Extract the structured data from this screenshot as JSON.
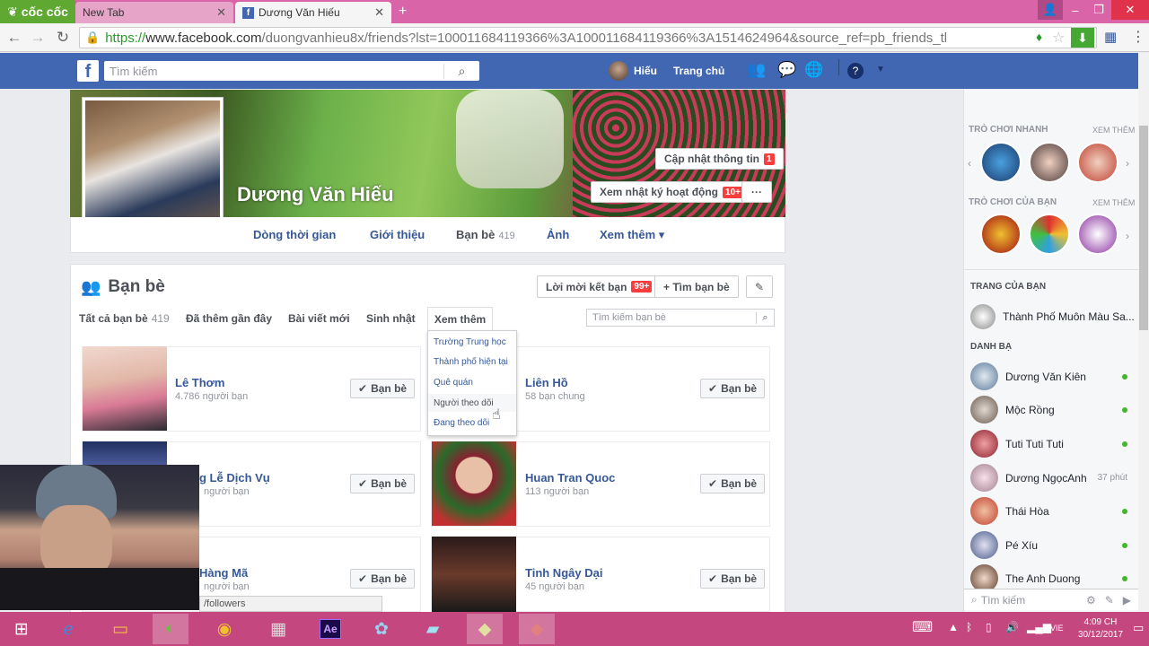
{
  "browser": {
    "brand": "cốc cốc",
    "tabs": [
      {
        "label": "New Tab"
      },
      {
        "label": "Dương Văn Hiếu"
      }
    ],
    "url_scheme": "https://",
    "url_domain": "www.facebook.com",
    "url_path": "/duongvanhieu8x/friends?lst=100011684119366%3A100011684119366%3A1514624964&source_ref=pb_friends_tl"
  },
  "fb_header": {
    "search_placeholder": "Tìm kiếm",
    "user_name": "Hiếu",
    "home": "Trang chủ"
  },
  "profile": {
    "name": "Dương Văn Hiếu",
    "update_info": "Cập nhật thông tin",
    "update_badge": "1",
    "activity_log": "Xem nhật ký hoạt động",
    "activity_badge": "10+",
    "more_dots": "···",
    "nav": {
      "timeline": "Dòng thời gian",
      "about": "Giới thiệu",
      "friends": "Bạn bè",
      "friends_count": "419",
      "photos": "Ảnh",
      "more": "Xem thêm ▾"
    }
  },
  "friends_section": {
    "title": "Bạn bè",
    "requests": "Lời mời kết bạn",
    "requests_badge": "99+",
    "find_friends": "+ Tìm bạn bè",
    "tabs": {
      "all": "Tất cả bạn bè",
      "all_count": "419",
      "recent": "Đã thêm gần đây",
      "posts": "Bài viết mới",
      "birthdays": "Sinh nhật",
      "more": "Xem thêm"
    },
    "search_placeholder": "Tìm kiếm bạn bè",
    "dropdown": [
      "Trường Trung học",
      "Thành phố hiện tại",
      "Quê quán",
      "Người theo dõi",
      "Đang theo dõi"
    ],
    "friend_button": "Bạn bè",
    "friends": [
      {
        "name": "Lê Thơm",
        "sub": "4.786 người bạn"
      },
      {
        "name": "Liên Hồ",
        "sub": "58 bạn chung"
      },
      {
        "name": "g Lễ Dịch Vụ",
        "sub": "người bạn"
      },
      {
        "name": "Huan Tran Quoc",
        "sub": "113 người bạn"
      },
      {
        "name": "Hàng Mã",
        "sub": "người bạn"
      },
      {
        "name": "Tinh Ngây Dại",
        "sub": "45 người bạn"
      }
    ]
  },
  "status_url": "/followers",
  "right_sidebar": {
    "quick_games": "TRÒ CHƠI NHANH",
    "your_games": "TRÒ CHƠI CỦA BẠN",
    "see_all": "XEM THÊM",
    "your_pages": "TRANG CỦA BẠN",
    "page_name": "Thành Phố Muôn Màu Sa...",
    "contacts_title": "DANH BẠ",
    "contacts": [
      {
        "name": "Dương Văn Kiên",
        "status": ""
      },
      {
        "name": "Mộc Rồng",
        "status": ""
      },
      {
        "name": "Tuti Tuti Tuti",
        "status": ""
      },
      {
        "name": "Dương NgọcAnh",
        "status": "37 phút"
      },
      {
        "name": "Thái Hòa",
        "status": ""
      },
      {
        "name": "Pé Xíu",
        "status": ""
      },
      {
        "name": "The Anh Duong",
        "status": ""
      }
    ],
    "chat_search": "Tìm kiếm"
  },
  "taskbar": {
    "lang": "VIE",
    "time": "4:09 CH",
    "date": "30/12/2017"
  }
}
